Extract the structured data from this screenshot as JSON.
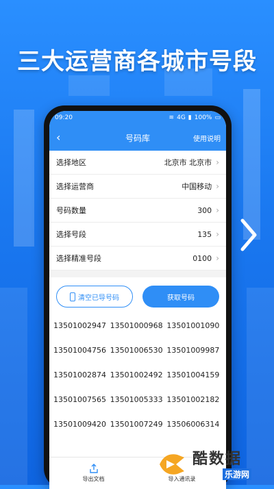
{
  "promo": {
    "headline": "三大运营商各城市号段"
  },
  "status_bar": {
    "time": "09:20",
    "network": "4G",
    "battery": "100%"
  },
  "navbar": {
    "title": "号码库",
    "help_label": "使用说明"
  },
  "settings": [
    {
      "label": "选择地区",
      "value": "北京市  北京市"
    },
    {
      "label": "选择运营商",
      "value": "中国移动"
    },
    {
      "label": "号码数量",
      "value": "300"
    },
    {
      "label": "选择号段",
      "value": "135"
    },
    {
      "label": "选择精准号段",
      "value": "0100"
    }
  ],
  "buttons": {
    "clear_label": "清空已导号码",
    "fetch_label": "获取号码"
  },
  "numbers": [
    "13501002947",
    "13501000968",
    "13501001090",
    "13501004756",
    "13501006530",
    "13501009987",
    "13501002874",
    "13501002492",
    "13501004159",
    "13501007565",
    "13501005333",
    "13501002182",
    "13501009420",
    "13501007249",
    "13506006314"
  ],
  "bottom_tabs": {
    "export_label": "导出文档",
    "import_label": "导入通讯录"
  },
  "watermark": {
    "brand": "酷数据",
    "sub": "乐游网"
  },
  "colors": {
    "accent": "#2f8ef6",
    "background": "#1a78f0"
  },
  "icons": {
    "back": "chevron-left-icon",
    "chevron": "chevron-right-icon",
    "export": "share-icon",
    "next": "next-arrow-icon"
  }
}
